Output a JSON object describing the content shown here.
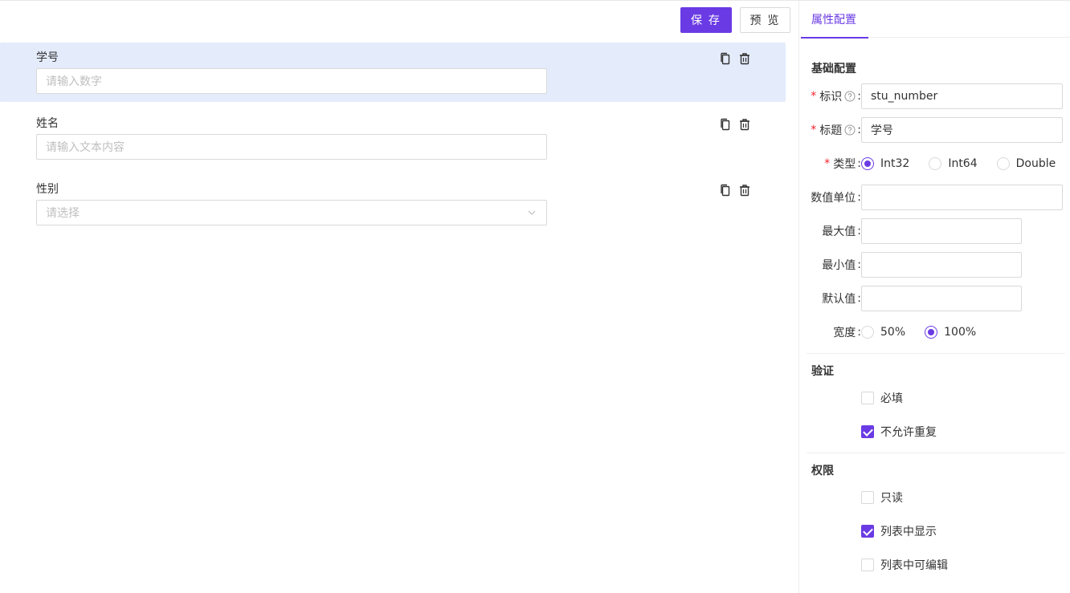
{
  "toolbar": {
    "save_label": "保 存",
    "preview_label": "预 览"
  },
  "form": {
    "fields": [
      {
        "label": "学号",
        "placeholder": "请输入数字",
        "type": "number",
        "selected": true
      },
      {
        "label": "姓名",
        "placeholder": "请输入文本内容",
        "type": "text",
        "selected": false
      },
      {
        "label": "性别",
        "placeholder": "请选择",
        "type": "select",
        "selected": false
      }
    ],
    "action_icons": [
      "copy-icon",
      "delete-icon"
    ]
  },
  "panel": {
    "tab": "属性配置",
    "basic": {
      "title": "基础配置",
      "id_label": "标识",
      "id_value": "stu_number",
      "title_label": "标题",
      "title_value": "学号",
      "type_label": "类型",
      "type_options": [
        "Int32",
        "Int64",
        "Double"
      ],
      "type_selected": "Int32",
      "unit_label": "数值单位",
      "unit_value": "",
      "max_label": "最大值",
      "max_value": "",
      "min_label": "最小值",
      "min_value": "",
      "default_label": "默认值",
      "default_value": "",
      "width_label": "宽度",
      "width_options": [
        "50%",
        "100%"
      ],
      "width_selected": "100%"
    },
    "validation": {
      "title": "验证",
      "required_label": "必填",
      "required_checked": false,
      "unique_label": "不允许重复",
      "unique_checked": true
    },
    "permission": {
      "title": "权限",
      "readonly_label": "只读",
      "readonly_checked": false,
      "show_in_list_label": "列表中显示",
      "show_in_list_checked": true,
      "editable_in_list_label": "列表中可编辑",
      "editable_in_list_checked": false
    }
  },
  "colors": {
    "accent": "#6a3be4",
    "selected_row": "#e4ebfb",
    "required": "#f5222d"
  }
}
